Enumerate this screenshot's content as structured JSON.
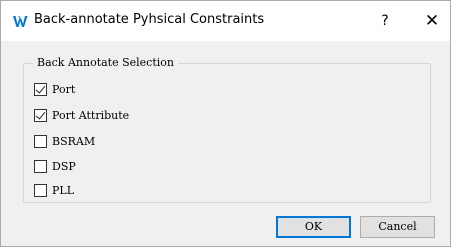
{
  "window": {
    "title": "Back-annotate Pyhsical Constraints",
    "help_label": "?",
    "close_label": "✕",
    "icon": "gowin-logo-icon",
    "icon_color": "#0078d7"
  },
  "group": {
    "legend": "Back Annotate Selection",
    "items": [
      {
        "label": "Port",
        "checked": true
      },
      {
        "label": "Port Attribute",
        "checked": true
      },
      {
        "label": "BSRAM",
        "checked": false
      },
      {
        "label": "DSP",
        "checked": false
      },
      {
        "label": "PLL",
        "checked": false
      }
    ]
  },
  "buttons": {
    "ok_label": "OK",
    "cancel_label": "Cancel"
  }
}
